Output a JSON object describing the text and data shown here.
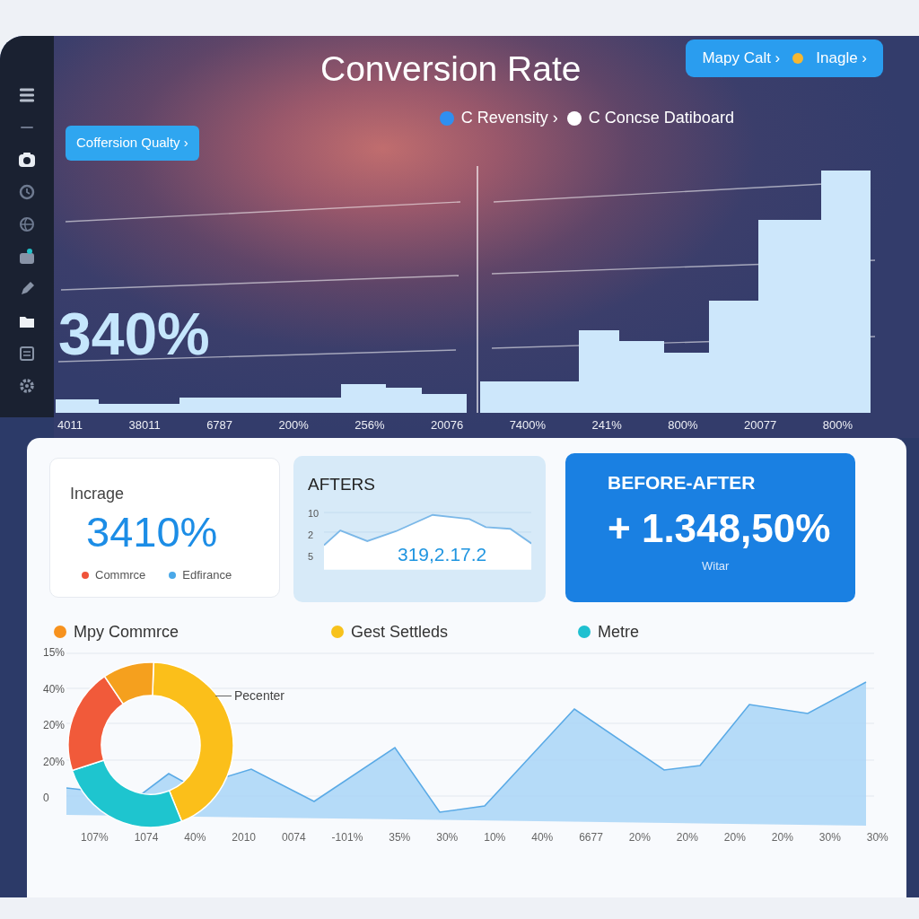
{
  "header": {
    "title": "Conversion Rate",
    "pill": [
      {
        "label": "Mapy Calt ›"
      },
      {
        "label": "Inagle ›",
        "color": "#f5b731"
      }
    ]
  },
  "filter_button": "Coffersion Qualty ›",
  "legend": [
    {
      "label": "C Revensity ›",
      "color": "#2f8ff0"
    },
    {
      "label": "C Concse Datiboard",
      "color": "#ffffff"
    }
  ],
  "main_chart": {
    "big_value": "340%",
    "x_labels": [
      "4011",
      "38011",
      "6787",
      "200%",
      "256%",
      "20076",
      "7400%",
      "241%",
      "800%",
      "20077",
      "800%"
    ]
  },
  "cards": [
    {
      "kind": "stat",
      "title": "Incrage",
      "value": "3410%",
      "legend": [
        {
          "label": "Commrce",
          "color": "#f0533a"
        },
        {
          "label": "Edfirance",
          "color": "#4aa8e8"
        }
      ]
    },
    {
      "kind": "sparkline",
      "title": "AFTERS",
      "y_labels": [
        "10",
        "2",
        "5"
      ],
      "value": "319,2.17.2"
    },
    {
      "kind": "highlight",
      "title": "BEFORE-AFTER",
      "value": "+ 1.348,50%",
      "caption": "Witar"
    }
  ],
  "trend": {
    "legend": [
      {
        "label": "Mpy Commrce",
        "color": "#f7921e"
      },
      {
        "label": "Gest Settleds",
        "color": "#f7c21c"
      },
      {
        "label": "Metre",
        "color": "#1fc0d0"
      }
    ],
    "y_labels": [
      "15%",
      "40%",
      "20%",
      "20%",
      "0"
    ],
    "x_labels": [
      "107%",
      "1074",
      "40%",
      "2010",
      "0074",
      "-101%",
      "35%",
      "30%",
      "10%",
      "40%",
      "6677",
      "20%",
      "20%",
      "20%",
      "20%",
      "30%",
      "30%"
    ],
    "donut": {
      "slices": [
        {
          "color": "#fbbf1a"
        },
        {
          "color": "#1ec5cf"
        },
        {
          "color": "#f15a3a"
        },
        {
          "color": "#f5a01e"
        }
      ],
      "callout": "Pecenter"
    }
  }
}
